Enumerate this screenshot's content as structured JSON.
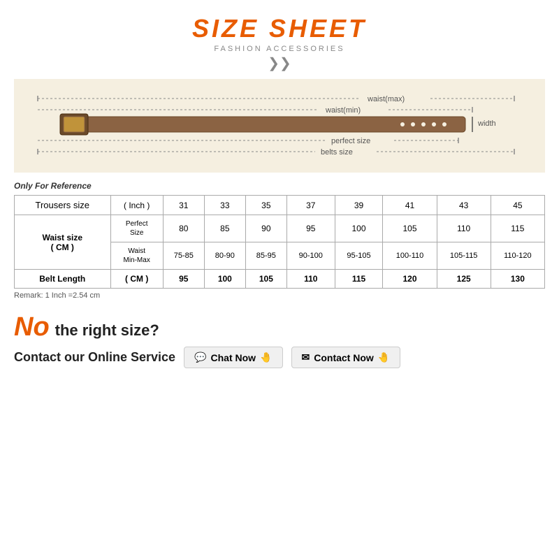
{
  "title": {
    "main": "SIZE SHEET",
    "sub": "FASHION ACCESSORIES",
    "chevron": "»"
  },
  "belt_diagram": {
    "rows": [
      {
        "label_left": "",
        "label_right": "waist(max)"
      },
      {
        "label_left": "",
        "label_right": "waist(min)"
      },
      {
        "label_right": "perfect size"
      },
      {
        "label_right": "belts size"
      }
    ],
    "width_label": "width"
  },
  "table": {
    "only_ref": "Only For Reference",
    "headers": [
      "Trousers size",
      "( Inch )",
      "31",
      "33",
      "35",
      "37",
      "39",
      "41",
      "43",
      "45"
    ],
    "perfect_size_label": "Perfect Size",
    "perfect_size_values": [
      "80",
      "85",
      "90",
      "95",
      "100",
      "105",
      "110",
      "115"
    ],
    "waist_size_label": "Waist size\n( CM )",
    "waist_min_max_label": "Waist\nMin-Max",
    "waist_min_max_values": [
      "75-85",
      "80-90",
      "85-95",
      "90-100",
      "95-105",
      "100-110",
      "105-115",
      "110-120"
    ],
    "belt_length_label": "Belt Length",
    "belt_length_unit": "( CM )",
    "belt_length_values": [
      "95",
      "100",
      "105",
      "110",
      "115",
      "120",
      "125",
      "130"
    ],
    "remark": "Remark: 1 Inch =2.54 cm"
  },
  "bottom": {
    "no_text": "No",
    "right_size_text": "the right size?",
    "contact_label": "Contact our Online Service",
    "chat_now": "Chat Now",
    "contact_now": "Contact Now",
    "chat_icon": "💬",
    "contact_icon": "✉",
    "hand_icon": "👋"
  }
}
